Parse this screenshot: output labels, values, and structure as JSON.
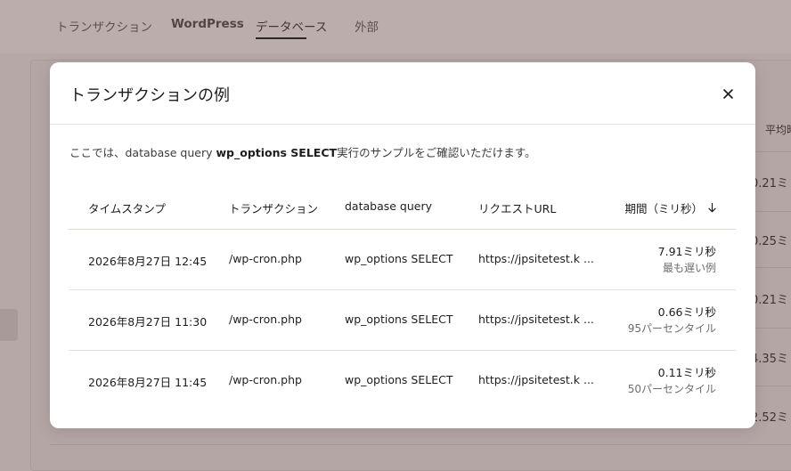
{
  "background": {
    "tabs": [
      {
        "label": "トランザクション"
      },
      {
        "label": "WordPress"
      },
      {
        "label": "データベース"
      },
      {
        "label": "外部"
      }
    ],
    "column_header_partial": "平均時",
    "values_partial": [
      "0.21ミ",
      "0.25ミ",
      "0.21ミ",
      "4.35ミ",
      "2.52ミ"
    ]
  },
  "modal": {
    "title": "トランザクションの例",
    "description_prefix": "ここでは、database query ",
    "description_bold": "wp_options SELECT",
    "description_suffix": "実行のサンプルをご確認いただけます。",
    "columns": {
      "timestamp": "タイムスタンプ",
      "transaction": "トランザクション",
      "query": "database query",
      "url": "リクエストURL",
      "duration": "期間（ミリ秒）"
    },
    "rows": [
      {
        "timestamp": "2026年8月27日 12:45",
        "transaction": "/wp-cron.php",
        "query": "wp_options SELECT",
        "url": "https://jpsitetest.k ...",
        "duration": "7.91ミリ秒",
        "note": "最も遅い例"
      },
      {
        "timestamp": "2026年8月27日 11:30",
        "transaction": "/wp-cron.php",
        "query": "wp_options SELECT",
        "url": "https://jpsitetest.k ...",
        "duration": "0.66ミリ秒",
        "note": "95パーセンタイル"
      },
      {
        "timestamp": "2026年8月27日 11:45",
        "transaction": "/wp-cron.php",
        "query": "wp_options SELECT",
        "url": "https://jpsitetest.k ...",
        "duration": "0.11ミリ秒",
        "note": "50パーセンタイル"
      }
    ]
  },
  "icons": {
    "close": "close-icon",
    "sort": "arrow-down-icon"
  },
  "colors": {
    "overlay": "#b7a8a8",
    "modal_bg": "#ffffff",
    "header_divider": "#e4d8cf"
  }
}
